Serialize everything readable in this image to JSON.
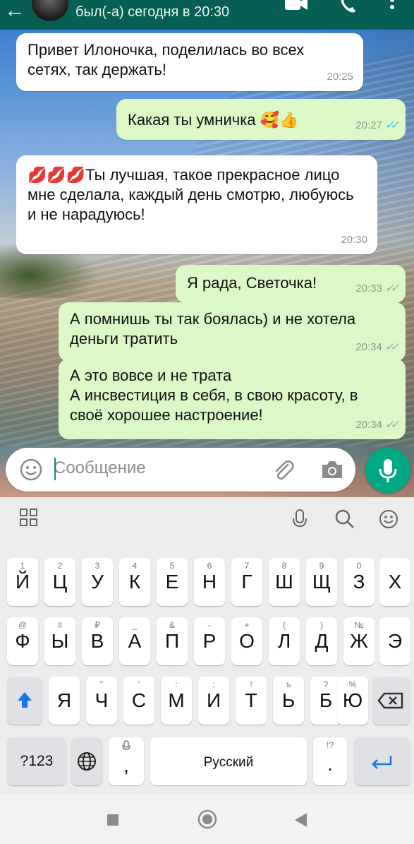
{
  "header": {
    "status": "был(-а) сегодня в 20:30"
  },
  "messages": [
    {
      "text": "Привет Илоночка, поделилась во всех сетях, так держать!",
      "time": "20:25",
      "direction": "in"
    },
    {
      "text": "Какая ты умничка 🥰👍",
      "time": "20:27",
      "direction": "out",
      "ticks": "read"
    },
    {
      "text": "💋💋💋Ты лучшая, такое прекрасное лицо мне сделала, каждый день смотрю, любуюсь и не нарадуюсь!",
      "time": "20:30",
      "direction": "in"
    },
    {
      "text": "Я рада, Светочка!",
      "time": "20:33",
      "direction": "out",
      "ticks": "delivered"
    },
    {
      "text": "А помнишь ты так боялась) и не хотела деньги тратить",
      "time": "20:34",
      "direction": "out",
      "ticks": "delivered"
    },
    {
      "text": "А это вовсе и не трата\nА инсвестиция в себя, в свою красоту, в своё хорошее настроение!",
      "time": "20:34",
      "direction": "out",
      "ticks": "delivered"
    }
  ],
  "input": {
    "placeholder": "Сообщение"
  },
  "keyboard": {
    "row1": [
      {
        "key": "й",
        "hint": "1"
      },
      {
        "key": "ц",
        "hint": "2"
      },
      {
        "key": "у",
        "hint": "3"
      },
      {
        "key": "к",
        "hint": "4"
      },
      {
        "key": "е",
        "hint": "5"
      },
      {
        "key": "н",
        "hint": "6"
      },
      {
        "key": "г",
        "hint": "7"
      },
      {
        "key": "ш",
        "hint": "8"
      },
      {
        "key": "щ",
        "hint": "9"
      },
      {
        "key": "з",
        "hint": "0"
      },
      {
        "key": "х",
        "hint": ""
      }
    ],
    "row2": [
      {
        "key": "ф",
        "hint": "@"
      },
      {
        "key": "ы",
        "hint": "#"
      },
      {
        "key": "в",
        "hint": "₽"
      },
      {
        "key": "а",
        "hint": "_"
      },
      {
        "key": "п",
        "hint": "&"
      },
      {
        "key": "р",
        "hint": "-"
      },
      {
        "key": "о",
        "hint": "+"
      },
      {
        "key": "л",
        "hint": "("
      },
      {
        "key": "д",
        "hint": ")"
      },
      {
        "key": "ж",
        "hint": "№"
      },
      {
        "key": "э",
        "hint": ""
      }
    ],
    "row3": [
      {
        "key": "я",
        "hint": ""
      },
      {
        "key": "ч",
        "hint": "\""
      },
      {
        "key": "с",
        "hint": "'"
      },
      {
        "key": "м",
        "hint": ":"
      },
      {
        "key": "и",
        "hint": ";"
      },
      {
        "key": "т",
        "hint": "!"
      },
      {
        "key": "ь",
        "hint": "ъ"
      },
      {
        "key": "б",
        "hint": "?"
      },
      {
        "key": "ю",
        "hint": "%"
      }
    ],
    "symbols_label": "?123",
    "comma": ",",
    "comma_hint": "",
    "space_label": "Русский",
    "period": ".",
    "period_hint": "!?"
  },
  "colors": {
    "header": "#075e54",
    "bubble_in": "#ffffff",
    "bubble_out": "#dcf8c6",
    "accent": "#00a884",
    "read_ticks": "#34b7f1"
  }
}
